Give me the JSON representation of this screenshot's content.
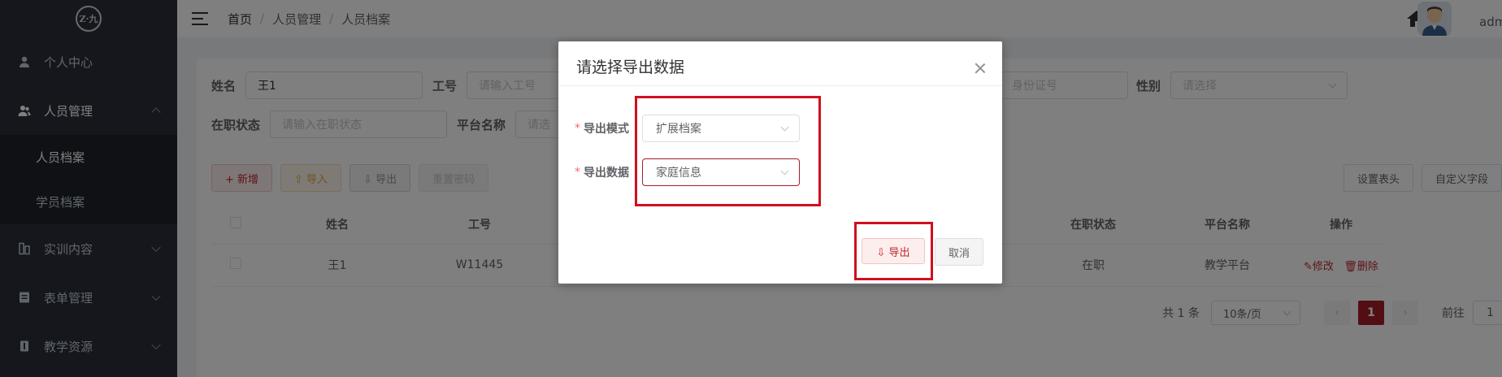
{
  "sidebar": {
    "logo_text": "Z·九",
    "items": [
      {
        "label": "个人中心",
        "icon": "user-icon"
      },
      {
        "label": "人员管理",
        "icon": "users-icon"
      },
      {
        "label": "实训内容",
        "icon": "book-icon"
      },
      {
        "label": "表单管理",
        "icon": "form-icon"
      },
      {
        "label": "教学资源",
        "icon": "resource-icon"
      }
    ],
    "subitems": [
      {
        "label": "人员档案"
      },
      {
        "label": "学员档案"
      }
    ]
  },
  "header": {
    "breadcrumb": [
      "首页",
      "人员管理",
      "人员档案"
    ],
    "breadcrumb_sep": "/",
    "user_name": "admin"
  },
  "filters": {
    "name_label": "姓名",
    "name_value": "王1",
    "id_label": "工号",
    "id_placeholder": "请输入工号",
    "idcard_placeholder": "身份证号",
    "gender_label": "性别",
    "gender_placeholder": "请选择",
    "status_label": "在职状态",
    "status_placeholder": "请输入在职状态",
    "platform_label": "平台名称",
    "platform_placeholder": "请选"
  },
  "toolbar": {
    "add": "+ 新增",
    "import": "⇧ 导入",
    "export": "⇩ 导出",
    "reset_pwd": "重置密码",
    "set_header": "设置表头",
    "custom_field": "自定义字段"
  },
  "table": {
    "headers": [
      "姓名",
      "工号",
      "在职状态",
      "平台名称",
      "操作"
    ],
    "rows": [
      {
        "name": "王1",
        "id": "W11445",
        "status": "在职",
        "platform": "教学平台",
        "edit": "修改",
        "delete": "删除"
      }
    ]
  },
  "pagination": {
    "total": "共 1 条",
    "page_size": "10条/页",
    "current": "1",
    "goto_label": "前往",
    "goto_value": "1"
  },
  "dialog": {
    "title": "请选择导出数据",
    "mode_label": "导出模式",
    "mode_value": "扩展档案",
    "data_label": "导出数据",
    "data_value": "家庭信息",
    "required_mark": "*",
    "export_button": "⇩ 导出",
    "cancel_button": "取消"
  },
  "colors": {
    "primary": "#a61c28",
    "sidebar_bg": "#2b2f3a",
    "highlight": "#d10f1f"
  }
}
